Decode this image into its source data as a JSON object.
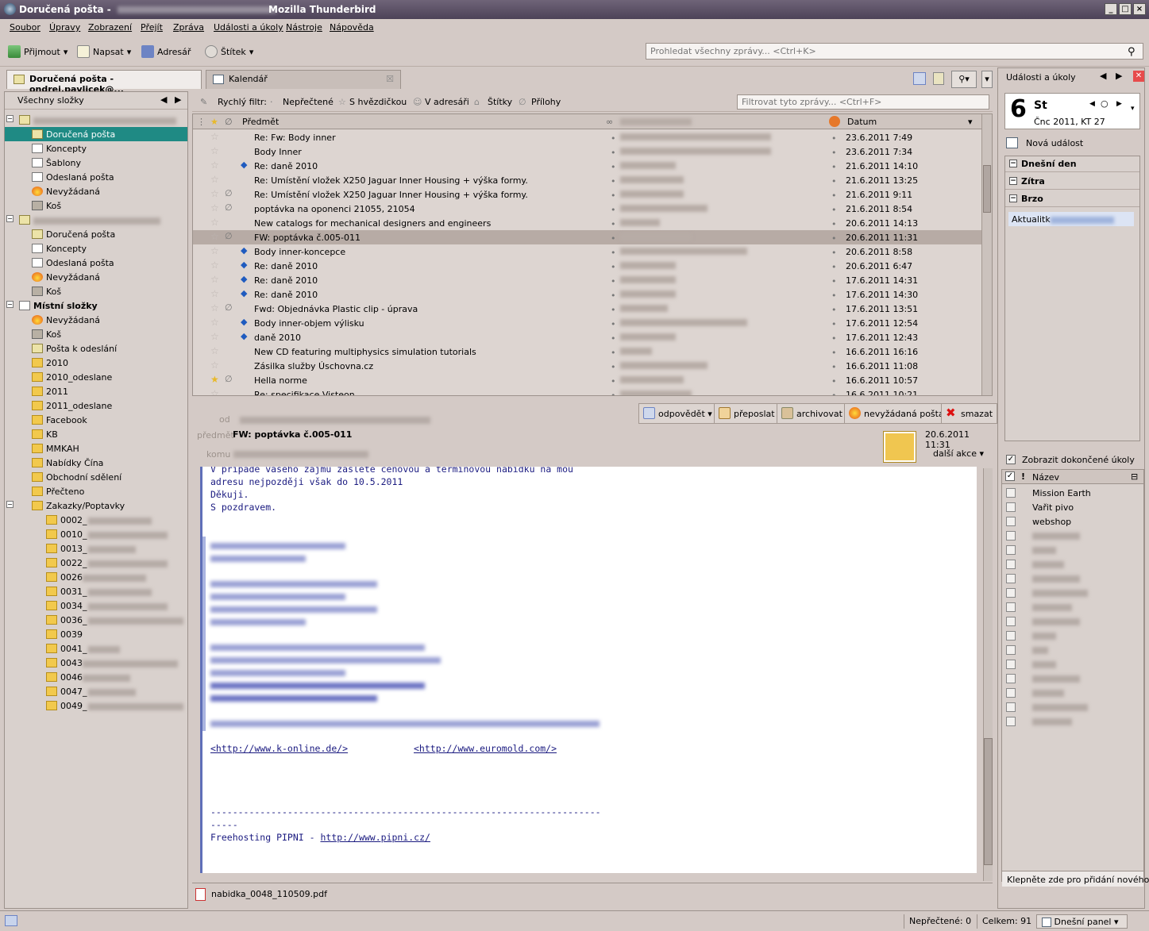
{
  "window": {
    "title": "Doručená pošta - ",
    "app": "Mozilla Thunderbird"
  },
  "menu": [
    "Soubor",
    "Úpravy",
    "Zobrazení",
    "Přejít",
    "Zpráva",
    "Události a úkoly",
    "Nástroje",
    "Nápověda"
  ],
  "toolbar": {
    "get": "Přijmout",
    "write": "Napsat",
    "addressbook": "Adresář",
    "tag": "Štítek",
    "search_placeholder": "Prohledat všechny zprávy... <Ctrl+K>"
  },
  "tabs": {
    "mail": "Doručená pošta - ondrej.pavlicek@...",
    "calendar": "Kalendář"
  },
  "folders": {
    "header": "Všechny složky",
    "local": "Místní složky",
    "acc1": [
      "Doručená pošta",
      "Koncepty",
      "Šablony",
      "Odeslaná pošta",
      "Nevyžádaná",
      "Koš"
    ],
    "acc2": [
      "Doručená pošta",
      "Koncepty",
      "Odeslaná pošta",
      "Nevyžádaná",
      "Koš"
    ],
    "localItems": [
      "Nevyžádaná",
      "Koš",
      "Pošta k odeslání",
      "2010",
      "2010_odeslane",
      "2011",
      "2011_odeslane",
      "Facebook",
      "KB",
      "MMKAH",
      "Nabídky Čína",
      "Obchodní sdělení",
      "Přečteno",
      "Zakazky/Poptavky"
    ],
    "sub": [
      "0002_",
      "0010_",
      "0013_",
      "0022_",
      "0026",
      "0031_",
      "0034_",
      "0036_",
      "0039",
      "0041_",
      "0043",
      "0046",
      "0047_",
      "0049_"
    ]
  },
  "quickfilter": {
    "label": "Rychlý filtr:",
    "unread": "Nepřečtené",
    "starred": "S hvězdičkou",
    "contact": "V adresáři",
    "tags": "Štítky",
    "attachment": "Přílohy",
    "placeholder": "Filtrovat tyto zprávy... <Ctrl+F>"
  },
  "list": {
    "col_subject": "Předmět",
    "col_date": "Datum",
    "rows": [
      {
        "s": "Re: Fw: Body inner",
        "d": "23.6.2011 7:49"
      },
      {
        "s": "Body Inner",
        "d": "23.6.2011 7:34"
      },
      {
        "s": "Re: daně 2010",
        "d": "21.6.2011 14:10"
      },
      {
        "s": "Re: Umístění vložek X250 Jaguar Inner Housing + výška formy.",
        "d": "21.6.2011 13:25"
      },
      {
        "s": "Re: Umístění vložek X250 Jaguar Inner Housing + výška formy.",
        "d": "21.6.2011 9:11"
      },
      {
        "s": "poptávka na oponenci 21055, 21054",
        "d": "21.6.2011 8:54"
      },
      {
        "s": "New catalogs for mechanical designers and engineers",
        "d": "20.6.2011 14:13"
      },
      {
        "s": "FW: poptávka č.005-011",
        "d": "20.6.2011 11:31"
      },
      {
        "s": "Body inner-koncepce",
        "d": "20.6.2011 8:58"
      },
      {
        "s": "Re: daně 2010",
        "d": "20.6.2011 6:47"
      },
      {
        "s": "Re: daně 2010",
        "d": "17.6.2011 14:31"
      },
      {
        "s": "Re: daně 2010",
        "d": "17.6.2011 14:30"
      },
      {
        "s": "Fwd: Objednávka Plastic clip - úprava",
        "d": "17.6.2011 13:51"
      },
      {
        "s": "Body inner-objem výlisku",
        "d": "17.6.2011 12:54"
      },
      {
        "s": "daně 2010",
        "d": "17.6.2011 12:43"
      },
      {
        "s": "New CD featuring multiphysics simulation tutorials",
        "d": "16.6.2011 16:16"
      },
      {
        "s": "Zásilka služby Úschovna.cz",
        "d": "16.6.2011 11:08"
      },
      {
        "s": "Hella norme",
        "d": "16.6.2011 10:57"
      },
      {
        "s": "Re: specifikace Visteon",
        "d": "16.6.2011 10:21"
      }
    ]
  },
  "preview": {
    "from_label": "od",
    "subject_label": "předmět",
    "to_label": "komu",
    "subject": "FW: poptávka č.005-011",
    "date": "20.6.2011 11:31",
    "more": "další akce",
    "btn_reply": "odpovědět",
    "btn_forward": "přeposlat",
    "btn_archive": "archivovat",
    "btn_junk": "nevyžádaná pošta",
    "btn_delete": "smazat",
    "lines": [
      "V případě vašeho zájmu zašlete cenovou a termínovou nabídku na mou",
      "adresu nejpozději však do 10.5.2011",
      "Děkuji.",
      "S pozdravem."
    ],
    "link1": "<http://www.k-online.de/>",
    "link2": "<http://www.euromold.com/>",
    "dashes": "-----------------------------------------------------------------------",
    "dash5": "-----",
    "fh": "Freehosting PIPNI - ",
    "fhlink": "http://www.pipni.cz/",
    "attachment": "nabidka_0048_110509.pdf"
  },
  "events": {
    "header": "Události a úkoly",
    "day": "6",
    "dow": "St",
    "date": "Čnc 2011, KT 27",
    "new": "Nová událost",
    "today": "Dnešní den",
    "tomorrow": "Zítra",
    "soon": "Brzo",
    "item": "Aktualitk"
  },
  "tasks": {
    "show": "Zobrazit dokončené úkoly",
    "col": "Název",
    "items": [
      "Mission Earth",
      "Vařit pivo",
      "webshop"
    ],
    "add": "Klepněte zde pro přidání nového"
  },
  "status": {
    "unread": "Nepřečtené: 0",
    "total": "Celkem: 91",
    "panel": "Dnešní panel"
  }
}
